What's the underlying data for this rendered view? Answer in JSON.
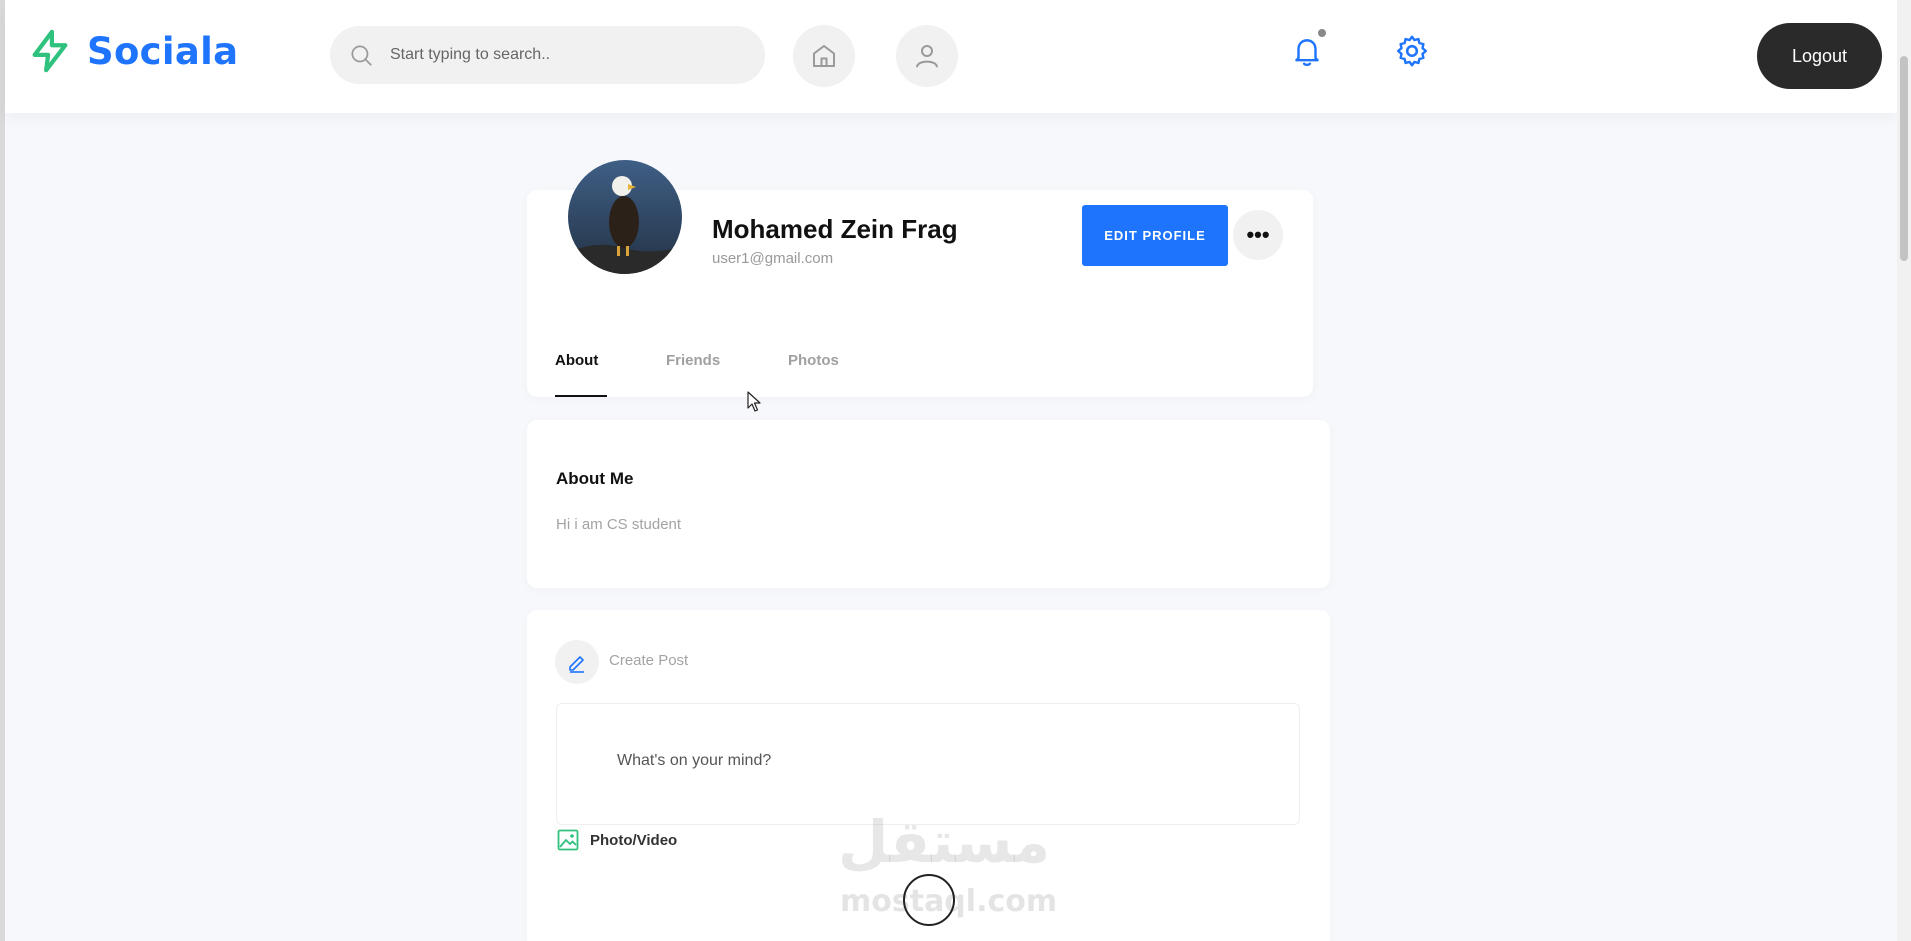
{
  "brand": {
    "name": "Sociala",
    "accent": "#1e74fd",
    "logo_icon": "lightning-bolt-icon",
    "logo_color": "#2ec27e"
  },
  "header": {
    "search_placeholder": "Start typing to search..",
    "icons": [
      "search-icon",
      "home-icon",
      "user-icon",
      "bell-icon",
      "gear-icon"
    ],
    "logout_label": "Logout"
  },
  "profile": {
    "name": "Mohamed Zein Frag",
    "email": "user1@gmail.com",
    "edit_label": "EDIT PROFILE",
    "more_label": "•••",
    "tabs": [
      {
        "label": "About",
        "active": true
      },
      {
        "label": "Friends",
        "active": false
      },
      {
        "label": "Photos",
        "active": false
      }
    ]
  },
  "about": {
    "title": "About Me",
    "text": "Hi i am CS student"
  },
  "create_post": {
    "title": "Create Post",
    "placeholder": "What's on your mind?",
    "photo_video_label": "Photo/Video"
  },
  "watermark": {
    "arabic": "مستقل",
    "latin": "mostaql.com"
  }
}
